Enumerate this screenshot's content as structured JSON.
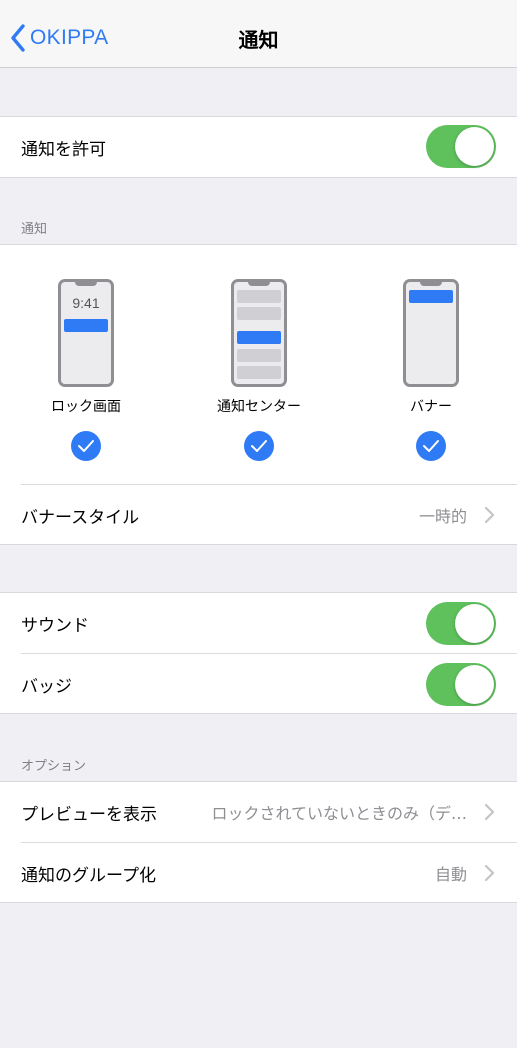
{
  "nav": {
    "back_label": "OKIPPA",
    "title": "通知"
  },
  "allow": {
    "label": "通知を許可",
    "enabled": true
  },
  "notifications_section": {
    "header": "通知",
    "options": [
      {
        "label": "ロック画面",
        "selected": true,
        "preview_time": "9:41"
      },
      {
        "label": "通知センター",
        "selected": true
      },
      {
        "label": "バナー",
        "selected": true
      }
    ],
    "banner_style": {
      "label": "バナースタイル",
      "value": "一時的"
    }
  },
  "sound": {
    "label": "サウンド",
    "enabled": true
  },
  "badge": {
    "label": "バッジ",
    "enabled": true
  },
  "options_section": {
    "header": "オプション",
    "preview": {
      "label": "プレビューを表示",
      "value": "ロックされていないときのみ（デ…"
    },
    "grouping": {
      "label": "通知のグループ化",
      "value": "自動"
    }
  },
  "colors": {
    "accent": "#2f7bf5",
    "toggle_on": "#5ec15c",
    "background": "#efeff4"
  }
}
